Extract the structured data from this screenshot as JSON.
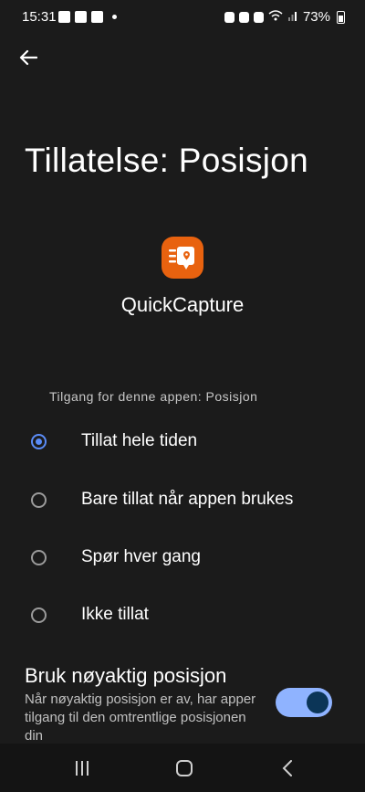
{
  "status_bar": {
    "time": "15:31",
    "battery_percent": "73%"
  },
  "page": {
    "title": "Tillatelse: Posisjon"
  },
  "app": {
    "name": "QuickCapture",
    "icon_color": "#e8620f"
  },
  "permission": {
    "section_label": "Tilgang for denne appen: Posisjon",
    "options": [
      {
        "label": "Tillat hele tiden",
        "selected": true
      },
      {
        "label": "Bare tillat når appen brukes",
        "selected": false
      },
      {
        "label": "Spør hver gang",
        "selected": false
      },
      {
        "label": "Ikke tillat",
        "selected": false
      }
    ]
  },
  "precise_location": {
    "title": "Bruk nøyaktig posisjon",
    "description": "Når nøyaktig posisjon er av, har apper tilgang til den omtrentlige posisjonen din",
    "enabled": true
  },
  "colors": {
    "accent": "#5b8cf7",
    "toggle_track": "#8fb3ff",
    "toggle_knob": "#0b3557",
    "background": "#1b1b1b"
  }
}
